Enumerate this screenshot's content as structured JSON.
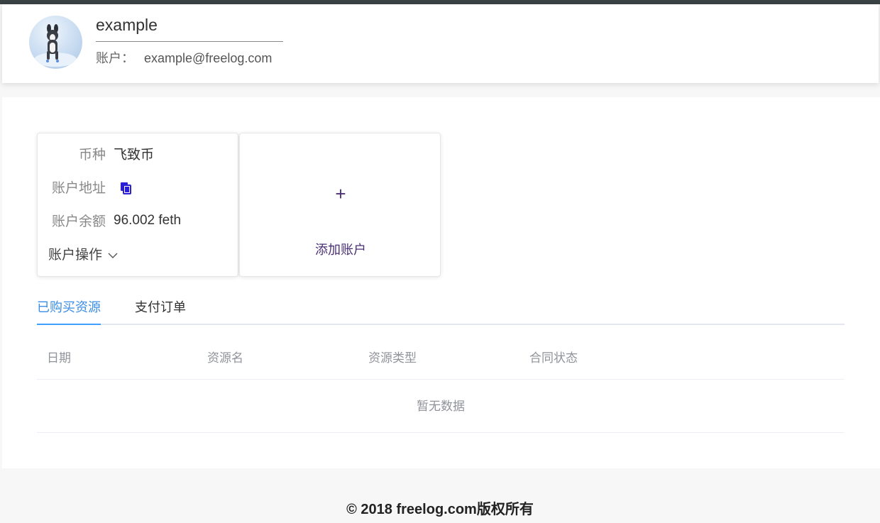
{
  "profile": {
    "username": "example",
    "account_label": "账户：",
    "account_email": "example@freelog.com"
  },
  "wallet": {
    "currency_label": "币种",
    "currency_value": "飞致币",
    "address_label": "账户地址",
    "copy_icon": "copy-icon",
    "balance_label": "账户余额",
    "balance_value": "96.002 feth",
    "actions_label": "账户操作"
  },
  "add_account": {
    "plus": "+",
    "label": "添加账户"
  },
  "tabs": [
    {
      "label": "已购买资源",
      "active": true
    },
    {
      "label": "支付订单",
      "active": false
    }
  ],
  "table": {
    "columns": [
      "日期",
      "资源名",
      "资源类型",
      "合同状态"
    ],
    "empty_text": "暂无数据"
  },
  "footer": {
    "text": "© 2018 freelog.com版权所有"
  },
  "colors": {
    "accent": "#409eff",
    "add_account": "#4a2f77",
    "top_bar": "#3a4243"
  }
}
